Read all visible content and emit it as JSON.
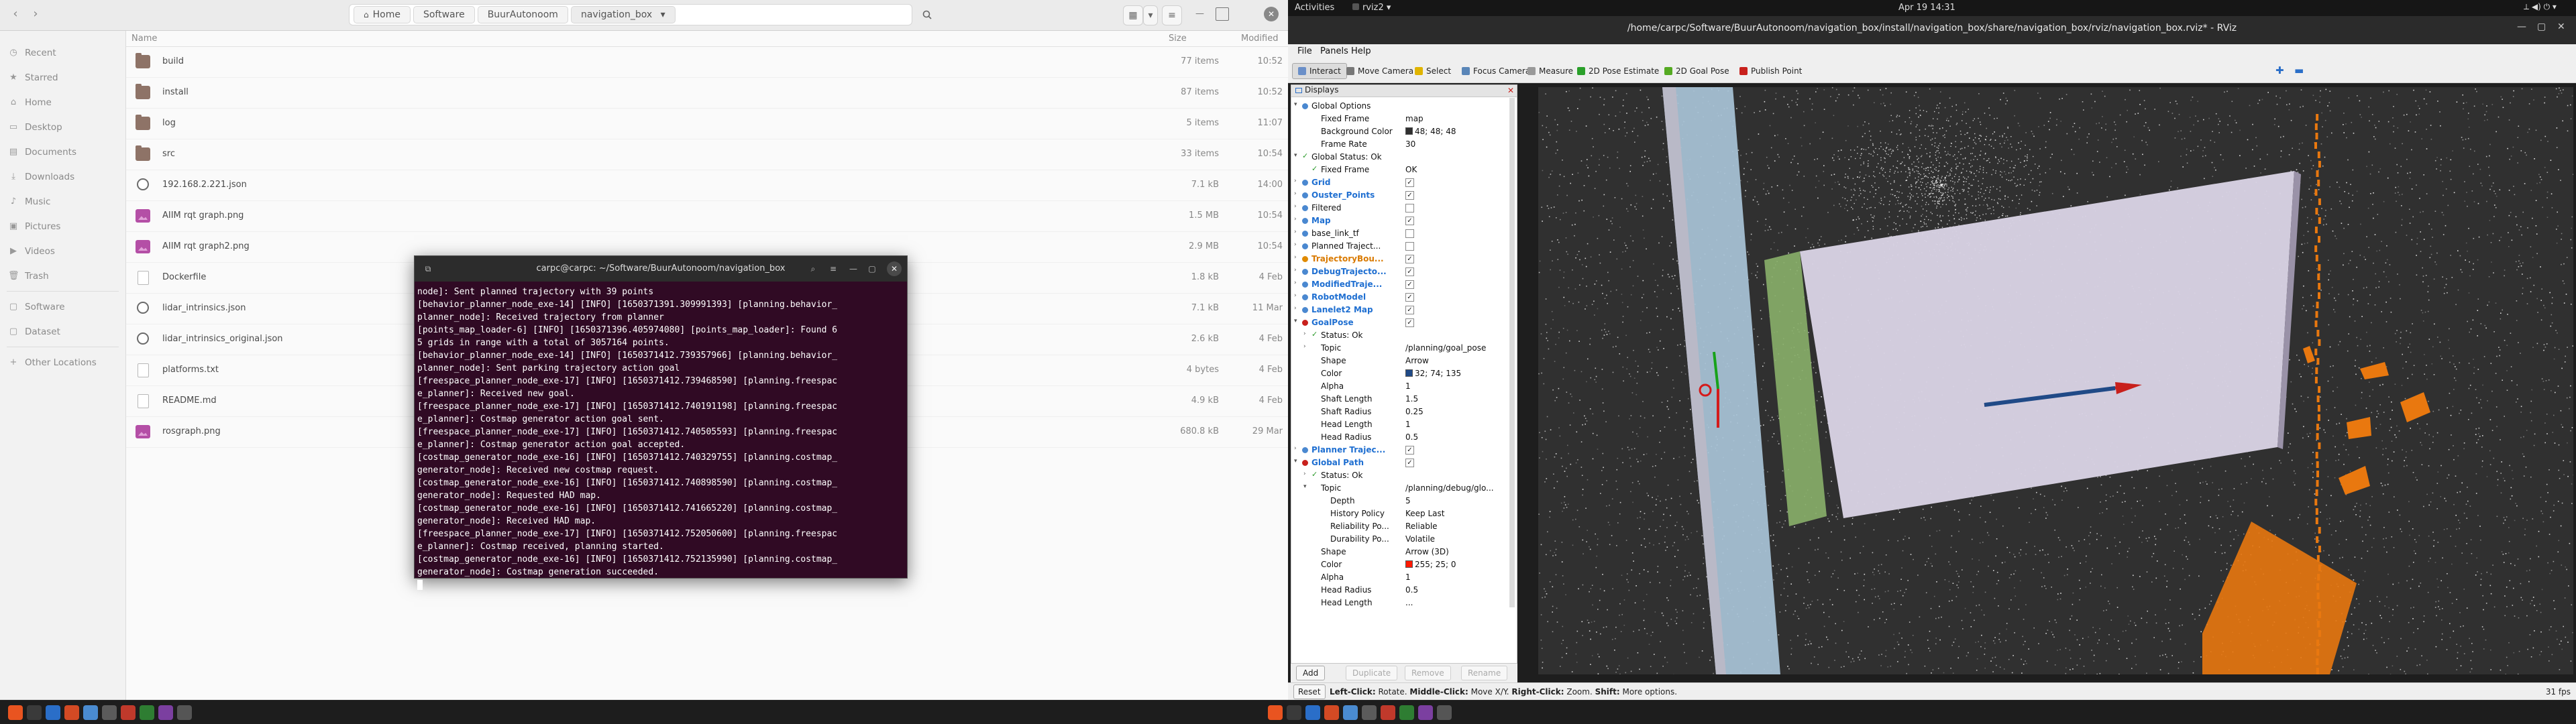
{
  "file_manager": {
    "nav_back": "‹",
    "nav_forward": "›",
    "path": [
      "Home",
      "Software",
      "BuurAutonoom",
      "navigation_box"
    ],
    "path_menu": "▾",
    "search_icon": "search-icon",
    "columns": {
      "name": "Name",
      "size": "Size",
      "modified": "Modified"
    },
    "sidebar": [
      {
        "icon": "◷",
        "label": "Recent"
      },
      {
        "icon": "★",
        "label": "Starred"
      },
      {
        "icon": "⌂",
        "label": "Home"
      },
      {
        "icon": "▭",
        "label": "Desktop"
      },
      {
        "icon": "▤",
        "label": "Documents"
      },
      {
        "icon": "⤓",
        "label": "Downloads"
      },
      {
        "icon": "♪",
        "label": "Music"
      },
      {
        "icon": "▣",
        "label": "Pictures"
      },
      {
        "icon": "▶",
        "label": "Videos"
      },
      {
        "icon": "🗑",
        "label": "Trash"
      },
      {
        "icon": "▢",
        "label": "Software"
      },
      {
        "icon": "▢",
        "label": "Dataset"
      },
      {
        "icon": "+",
        "label": "Other Locations"
      }
    ],
    "files": [
      {
        "name": "build",
        "type": "folder",
        "size": "77 items",
        "modified": "10:52"
      },
      {
        "name": "install",
        "type": "folder",
        "size": "87 items",
        "modified": "10:52"
      },
      {
        "name": "log",
        "type": "folder",
        "size": "5 items",
        "modified": "11:07"
      },
      {
        "name": "src",
        "type": "folder",
        "size": "33 items",
        "modified": "10:54"
      },
      {
        "name": "192.168.2.221.json",
        "type": "json",
        "size": "7.1 kB",
        "modified": "14:00"
      },
      {
        "name": "AIIM rqt graph.png",
        "type": "image",
        "size": "1.5 MB",
        "modified": "10:54"
      },
      {
        "name": "AIIM rqt graph2.png",
        "type": "image",
        "size": "2.9 MB",
        "modified": "10:54"
      },
      {
        "name": "Dockerfile",
        "type": "doc",
        "size": "1.8 kB",
        "modified": "4 Feb"
      },
      {
        "name": "lidar_intrinsics.json",
        "type": "json",
        "size": "7.1 kB",
        "modified": "11 Mar"
      },
      {
        "name": "lidar_intrinsics_original.json",
        "type": "json",
        "size": "2.6 kB",
        "modified": "4 Feb"
      },
      {
        "name": "platforms.txt",
        "type": "doc",
        "size": "4 bytes",
        "modified": "4 Feb"
      },
      {
        "name": "README.md",
        "type": "doc",
        "size": "4.9 kB",
        "modified": "4 Feb"
      },
      {
        "name": "rosgraph.png",
        "type": "image",
        "size": "680.8 kB",
        "modified": "29 Mar"
      }
    ]
  },
  "terminal": {
    "title": "carpc@carpc: ~/Software/BuurAutonoom/navigation_box",
    "lines": [
      "node]: Sent planned trajectory with 39 points",
      "[behavior_planner_node_exe-14] [INFO] [1650371391.309991393] [planning.behavior_",
      "planner_node]: Received trajectory from planner",
      "[points_map_loader-6] [INFO] [1650371396.405974080] [points_map_loader]: Found 6",
      "5 grids in range with a total of 3057164 points.",
      "[behavior_planner_node_exe-14] [INFO] [1650371412.739357966] [planning.behavior_",
      "planner_node]: Sent parking trajectory action goal",
      "[freespace_planner_node_exe-17] [INFO] [1650371412.739468590] [planning.freespac",
      "e_planner]: Received new goal.",
      "[freespace_planner_node_exe-17] [INFO] [1650371412.740191198] [planning.freespac",
      "e_planner]: Costmap generator action goal sent.",
      "[freespace_planner_node_exe-17] [INFO] [1650371412.740505593] [planning.freespac",
      "e_planner]: Costmap generator action goal accepted.",
      "[costmap_generator_node_exe-16] [INFO] [1650371412.740329755] [planning.costmap_",
      "generator_node]: Received new costmap request.",
      "[costmap_generator_node_exe-16] [INFO] [1650371412.740898590] [planning.costmap_",
      "generator_node]: Requested HAD map.",
      "[costmap_generator_node_exe-16] [INFO] [1650371412.741665220] [planning.costmap_",
      "generator_node]: Received HAD map.",
      "[freespace_planner_node_exe-17] [INFO] [1650371412.752050600] [planning.freespac",
      "e_planner]: Costmap received, planning started.",
      "[costmap_generator_node_exe-16] [INFO] [1650371412.752135990] [planning.costmap_",
      "generator_node]: Costmap generation succeeded."
    ]
  },
  "topbar": {
    "activities": "Activities",
    "app": "rviz2",
    "clock": "Apr 19  14:31"
  },
  "rviz": {
    "title": "/home/carpc/Software/BuurAutonoom/navigation_box/install/navigation_box/share/navigation_box/rviz/navigation_box.rviz* - RViz",
    "menu": [
      "File",
      "Panels",
      "Help"
    ],
    "tools": [
      {
        "label": "Interact",
        "color": "#6a8fc8"
      },
      {
        "label": "Move Camera",
        "color": "#777777"
      },
      {
        "label": "Select",
        "color": "#e0b400"
      },
      {
        "label": "Focus Camera",
        "color": "#5a86b8"
      },
      {
        "label": "Measure",
        "color": "#999999"
      },
      {
        "label": "2D Pose Estimate",
        "color": "#2aa02a"
      },
      {
        "label": "2D Goal Pose",
        "color": "#55aa22"
      },
      {
        "label": "Publish Point",
        "color": "#c8201c"
      }
    ],
    "displays_title": "Displays",
    "buttons": {
      "add": "Add",
      "duplicate": "Duplicate",
      "remove": "Remove",
      "rename": "Rename"
    },
    "status": {
      "reset": "Reset",
      "hint_bold1": "Left-Click:",
      "hint1": " Rotate. ",
      "hint_bold2": "Middle-Click:",
      "hint2": " Move X/Y. ",
      "hint_bold3": "Right-Click:",
      "hint3": " Zoom. ",
      "hint_bold4": "Shift:",
      "hint4": " More options.",
      "fps": "31 fps"
    },
    "tree": [
      {
        "d": 0,
        "arrow": "▾",
        "icon": "#4a88d0",
        "label": "Global Options"
      },
      {
        "d": 1,
        "label": "Fixed Frame",
        "value": "map"
      },
      {
        "d": 1,
        "label": "Background Color",
        "value": "48; 48; 48",
        "swatch": "#303030"
      },
      {
        "d": 1,
        "label": "Frame Rate",
        "value": "30"
      },
      {
        "d": 0,
        "arrow": "▾",
        "check": "✓",
        "label": "Global Status: Ok"
      },
      {
        "d": 1,
        "check": "✓",
        "label": "Fixed Frame",
        "value": "OK"
      },
      {
        "d": 0,
        "arrow": "›",
        "icon": "#4a88d0",
        "label": "Grid",
        "cls": "blue",
        "box": "✓"
      },
      {
        "d": 0,
        "arrow": "›",
        "icon": "#4a88d0",
        "label": "Ouster_Points",
        "cls": "blue",
        "box": "✓"
      },
      {
        "d": 0,
        "arrow": "›",
        "icon": "#4a88d0",
        "label": "Filtered",
        "box": ""
      },
      {
        "d": 0,
        "arrow": "›",
        "icon": "#4a88d0",
        "label": "Map",
        "cls": "blue",
        "box": "✓"
      },
      {
        "d": 0,
        "arrow": "›",
        "icon": "#4a88d0",
        "label": "base_link_tf",
        "box": ""
      },
      {
        "d": 0,
        "arrow": "›",
        "icon": "#4a88d0",
        "label": "Planned Traject...",
        "box": ""
      },
      {
        "d": 0,
        "arrow": "›",
        "icon": "#e08a00",
        "label": "TrajectoryBou...",
        "cls": "orange",
        "box": "✓"
      },
      {
        "d": 0,
        "arrow": "›",
        "icon": "#4a88d0",
        "label": "DebugTrajecto...",
        "cls": "blue",
        "box": "✓"
      },
      {
        "d": 0,
        "arrow": "›",
        "icon": "#4a88d0",
        "label": "ModifiedTraje...",
        "cls": "blue",
        "box": "✓"
      },
      {
        "d": 0,
        "arrow": "›",
        "icon": "#4a88d0",
        "label": "RobotModel",
        "cls": "blue",
        "box": "✓"
      },
      {
        "d": 0,
        "arrow": "›",
        "icon": "#4a88d0",
        "label": "Lanelet2 Map",
        "cls": "blue",
        "box": "✓"
      },
      {
        "d": 0,
        "arrow": "▾",
        "icon": "#c8201c",
        "label": "GoalPose",
        "cls": "blue",
        "box": "✓"
      },
      {
        "d": 1,
        "arrow": "›",
        "check": "✓",
        "label": "Status: Ok"
      },
      {
        "d": 1,
        "arrow": "›",
        "label": "Topic",
        "value": "/planning/goal_pose"
      },
      {
        "d": 1,
        "label": "Shape",
        "value": "Arrow"
      },
      {
        "d": 1,
        "label": "Color",
        "value": "32; 74; 135",
        "swatch": "#204a87"
      },
      {
        "d": 1,
        "label": "Alpha",
        "value": "1"
      },
      {
        "d": 1,
        "label": "Shaft Length",
        "value": "1.5"
      },
      {
        "d": 1,
        "label": "Shaft Radius",
        "value": "0.25"
      },
      {
        "d": 1,
        "label": "Head Length",
        "value": "1"
      },
      {
        "d": 1,
        "label": "Head Radius",
        "value": "0.5"
      },
      {
        "d": 0,
        "arrow": "›",
        "icon": "#4a88d0",
        "label": "Planner Trajec...",
        "cls": "blue",
        "box": "✓"
      },
      {
        "d": 0,
        "arrow": "▾",
        "icon": "#c8201c",
        "label": "Global Path",
        "cls": "blue",
        "box": "✓"
      },
      {
        "d": 1,
        "arrow": "›",
        "check": "✓",
        "label": "Status: Ok"
      },
      {
        "d": 1,
        "arrow": "▾",
        "label": "Topic",
        "value": "/planning/debug/glo..."
      },
      {
        "d": 2,
        "label": "Depth",
        "value": "5"
      },
      {
        "d": 2,
        "label": "History Policy",
        "value": "Keep Last"
      },
      {
        "d": 2,
        "label": "Reliability Po...",
        "value": "Reliable"
      },
      {
        "d": 2,
        "label": "Durability Po...",
        "value": "Volatile"
      },
      {
        "d": 1,
        "label": "Shape",
        "value": "Arrow (3D)"
      },
      {
        "d": 1,
        "label": "Color",
        "value": "255; 25; 0",
        "swatch": "#ff1900"
      },
      {
        "d": 1,
        "label": "Alpha",
        "value": "1"
      },
      {
        "d": 1,
        "label": "Head Radius",
        "value": "0.5"
      },
      {
        "d": 1,
        "label": "Head Length",
        "value": "..."
      }
    ]
  },
  "colors": {
    "terminal_bg": "#300a24",
    "viewport_bg": "#303030",
    "ground_plane": "#d8d2e4",
    "road_strip": "#a9c4d8",
    "obstacle": "#e9780f",
    "green_zone": "#8ab06a"
  }
}
